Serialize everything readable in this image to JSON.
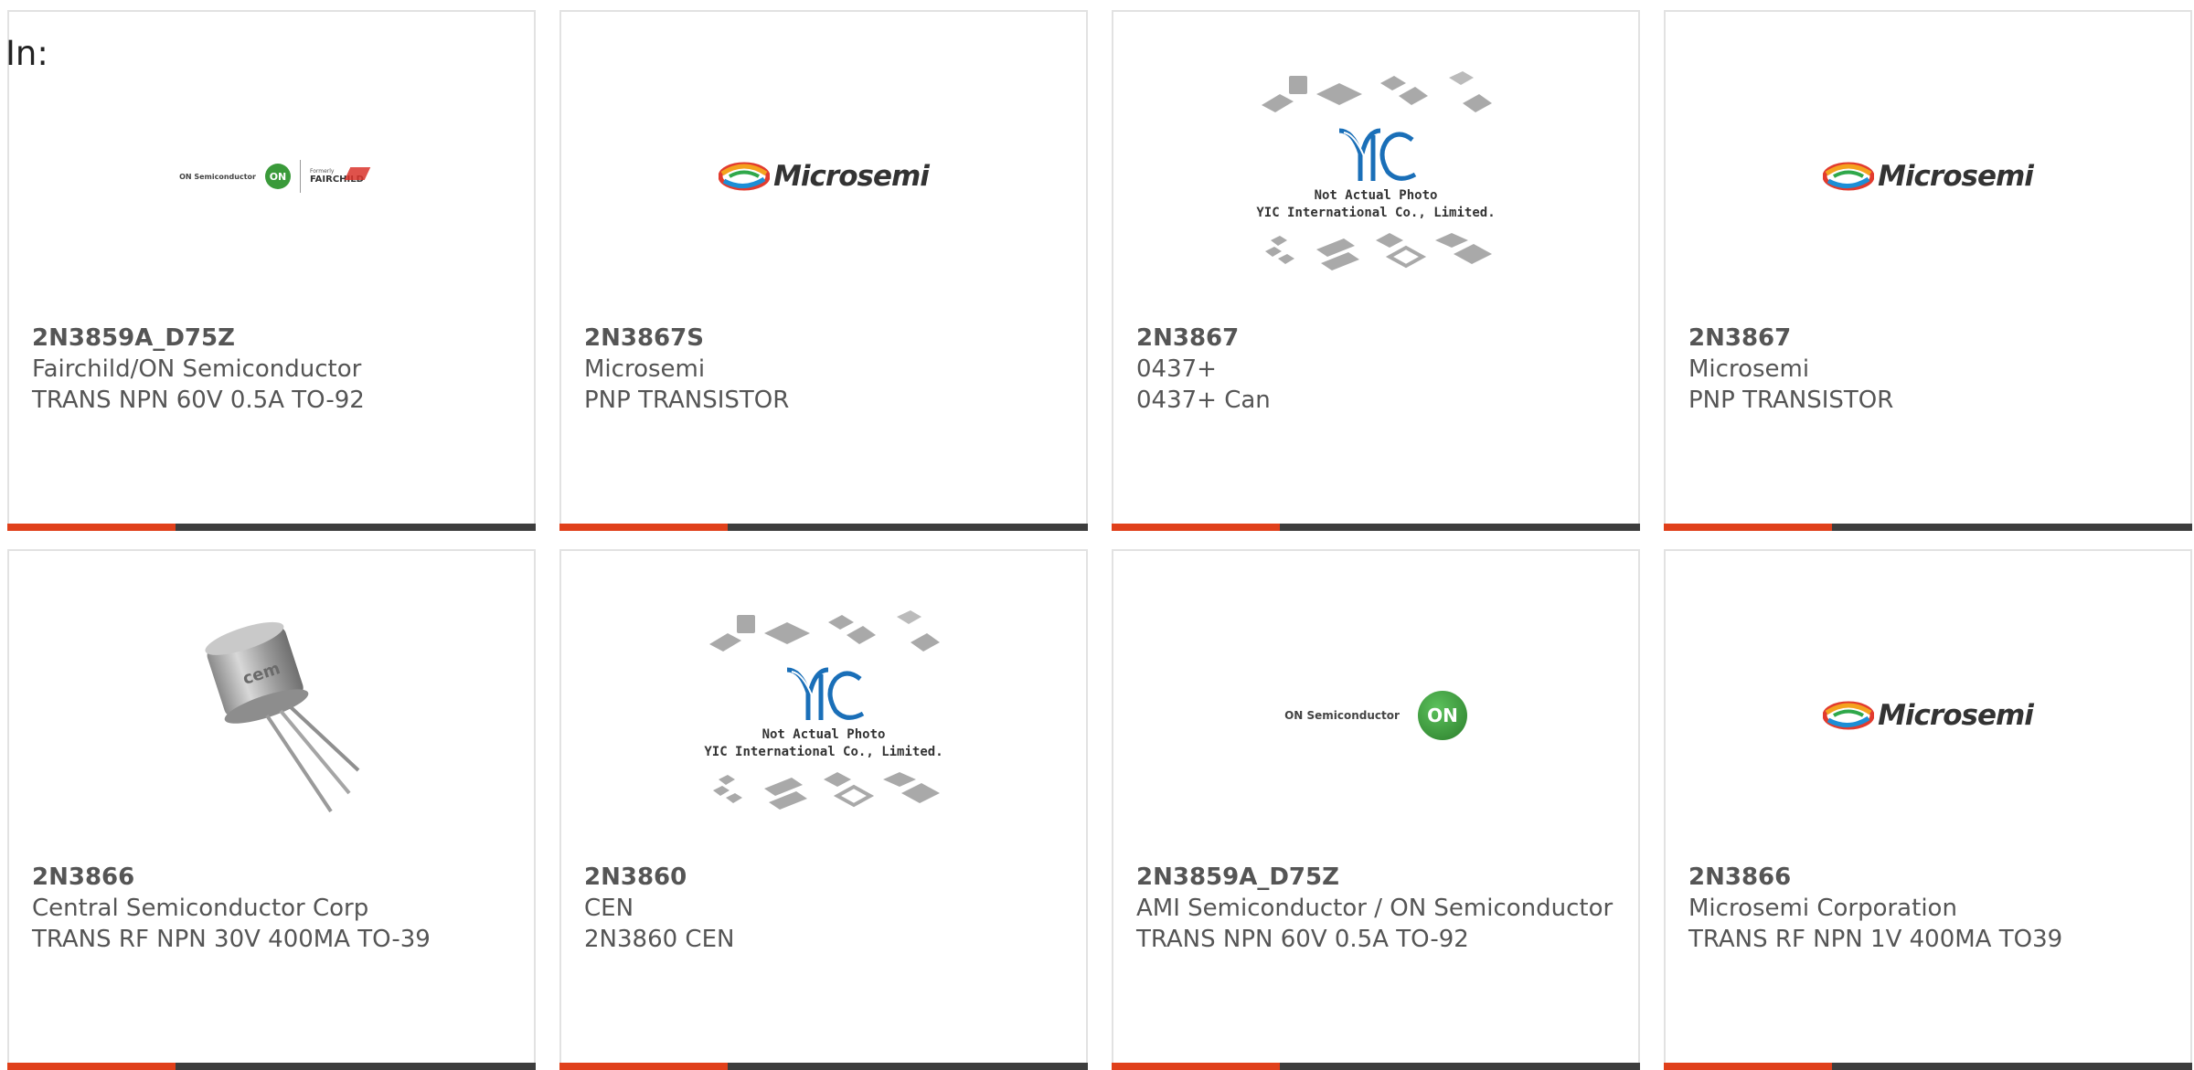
{
  "filter_label": "In:",
  "cards": [
    {
      "part_number": "2N3859A_D75Z",
      "manufacturer": "Fairchild/ON Semiconductor",
      "description": "TRANS NPN 60V 0.5A TO-92",
      "logo": {
        "type": "on-fairchild",
        "on_text": "ON Semiconductor",
        "on_symbol": "ON",
        "fair_small": "Formerly",
        "fair_word": "FAIRCHILD"
      }
    },
    {
      "part_number": "2N3867S",
      "manufacturer": "Microsemi",
      "description": "PNP TRANSISTOR",
      "logo": {
        "type": "microsemi",
        "word": "Microsemi"
      }
    },
    {
      "part_number": "2N3867",
      "manufacturer": "0437+",
      "description": "0437+ Can",
      "logo": {
        "type": "yic",
        "line1": "Not Actual Photo",
        "line2": "YIC International Co., Limited."
      }
    },
    {
      "part_number": "2N3867",
      "manufacturer": "Microsemi",
      "description": "PNP TRANSISTOR",
      "logo": {
        "type": "microsemi",
        "word": "Microsemi"
      }
    },
    {
      "part_number": "2N3866",
      "manufacturer": "Central Semiconductor Corp",
      "description": "TRANS RF NPN 30V 400MA TO-39",
      "logo": {
        "type": "transistor-photo",
        "marking": "cem"
      }
    },
    {
      "part_number": "2N3860",
      "manufacturer": "CEN",
      "description": "2N3860 CEN",
      "logo": {
        "type": "yic",
        "line1": "Not Actual Photo",
        "line2": "YIC International Co., Limited."
      }
    },
    {
      "part_number": "2N3859A_D75Z",
      "manufacturer": "AMI Semiconductor / ON Semiconductor",
      "description": "TRANS NPN 60V 0.5A TO-92",
      "logo": {
        "type": "on-semi",
        "on_text": "ON Semiconductor",
        "on_symbol": "ON"
      }
    },
    {
      "part_number": "2N3866",
      "manufacturer": "Microsemi Corporation",
      "description": "TRANS RF NPN 1V 400MA TO39",
      "logo": {
        "type": "microsemi",
        "word": "Microsemi"
      }
    }
  ],
  "colors": {
    "accent": "#e0401b",
    "bar": "#3d3d3d",
    "border": "#e2e2e2",
    "text": "#555555"
  }
}
